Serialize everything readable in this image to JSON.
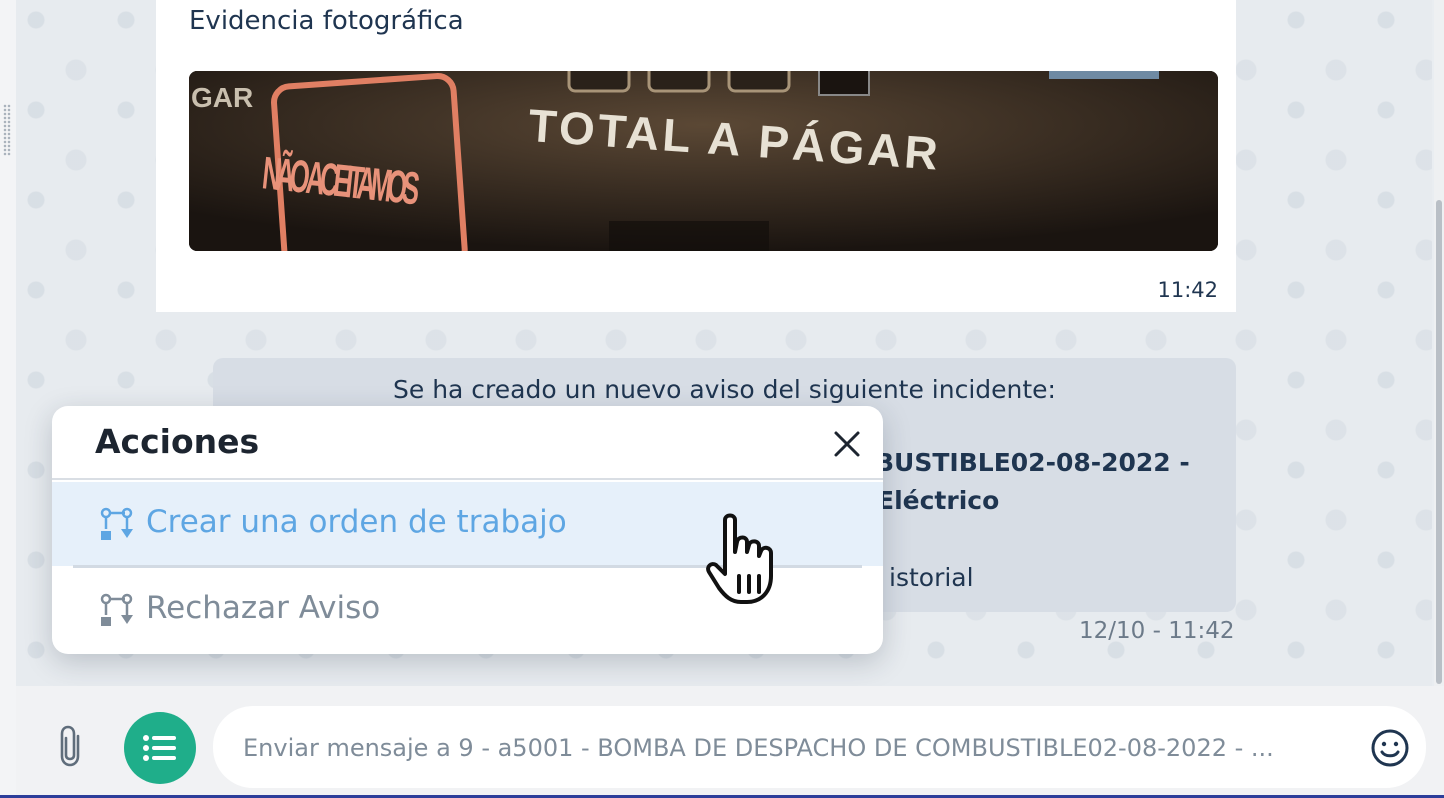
{
  "photo_message": {
    "title": "Evidencia fotográfica",
    "image_texts": [
      "NÃO ACEITAMOS",
      "TOTAL A PÁGAR",
      "GAR"
    ],
    "time": "11:42"
  },
  "notice_message": {
    "line1": "Se ha creado un nuevo aviso del siguiente incidente:",
    "bold_line1": "BUSTIBLE02-08-2022 -",
    "bold_line2": "Eléctrico",
    "link_text": "istorial",
    "timestamp": "12/10 - 11:42"
  },
  "actions_popup": {
    "title": "Acciones",
    "close_icon": "close-icon",
    "items": [
      {
        "label": "Crear una orden de trabajo",
        "icon": "workflow-icon",
        "state": "hover"
      },
      {
        "label": "Rechazar Aviso",
        "icon": "workflow-icon",
        "state": "normal"
      }
    ]
  },
  "composer": {
    "attach_icon": "paperclip-icon",
    "menu_icon": "list-icon",
    "placeholder": "Enviar mensaje a 9 - a5001 - BOMBA DE DESPACHO DE COMBUSTIBLE02-08-2022 - ...",
    "emoji_icon": "smiley-icon"
  },
  "colors": {
    "accent_green": "#1fae8a",
    "link_blue": "#5ea6e3",
    "text_dark": "#1f3550",
    "notice_bg": "#d7dde5"
  }
}
